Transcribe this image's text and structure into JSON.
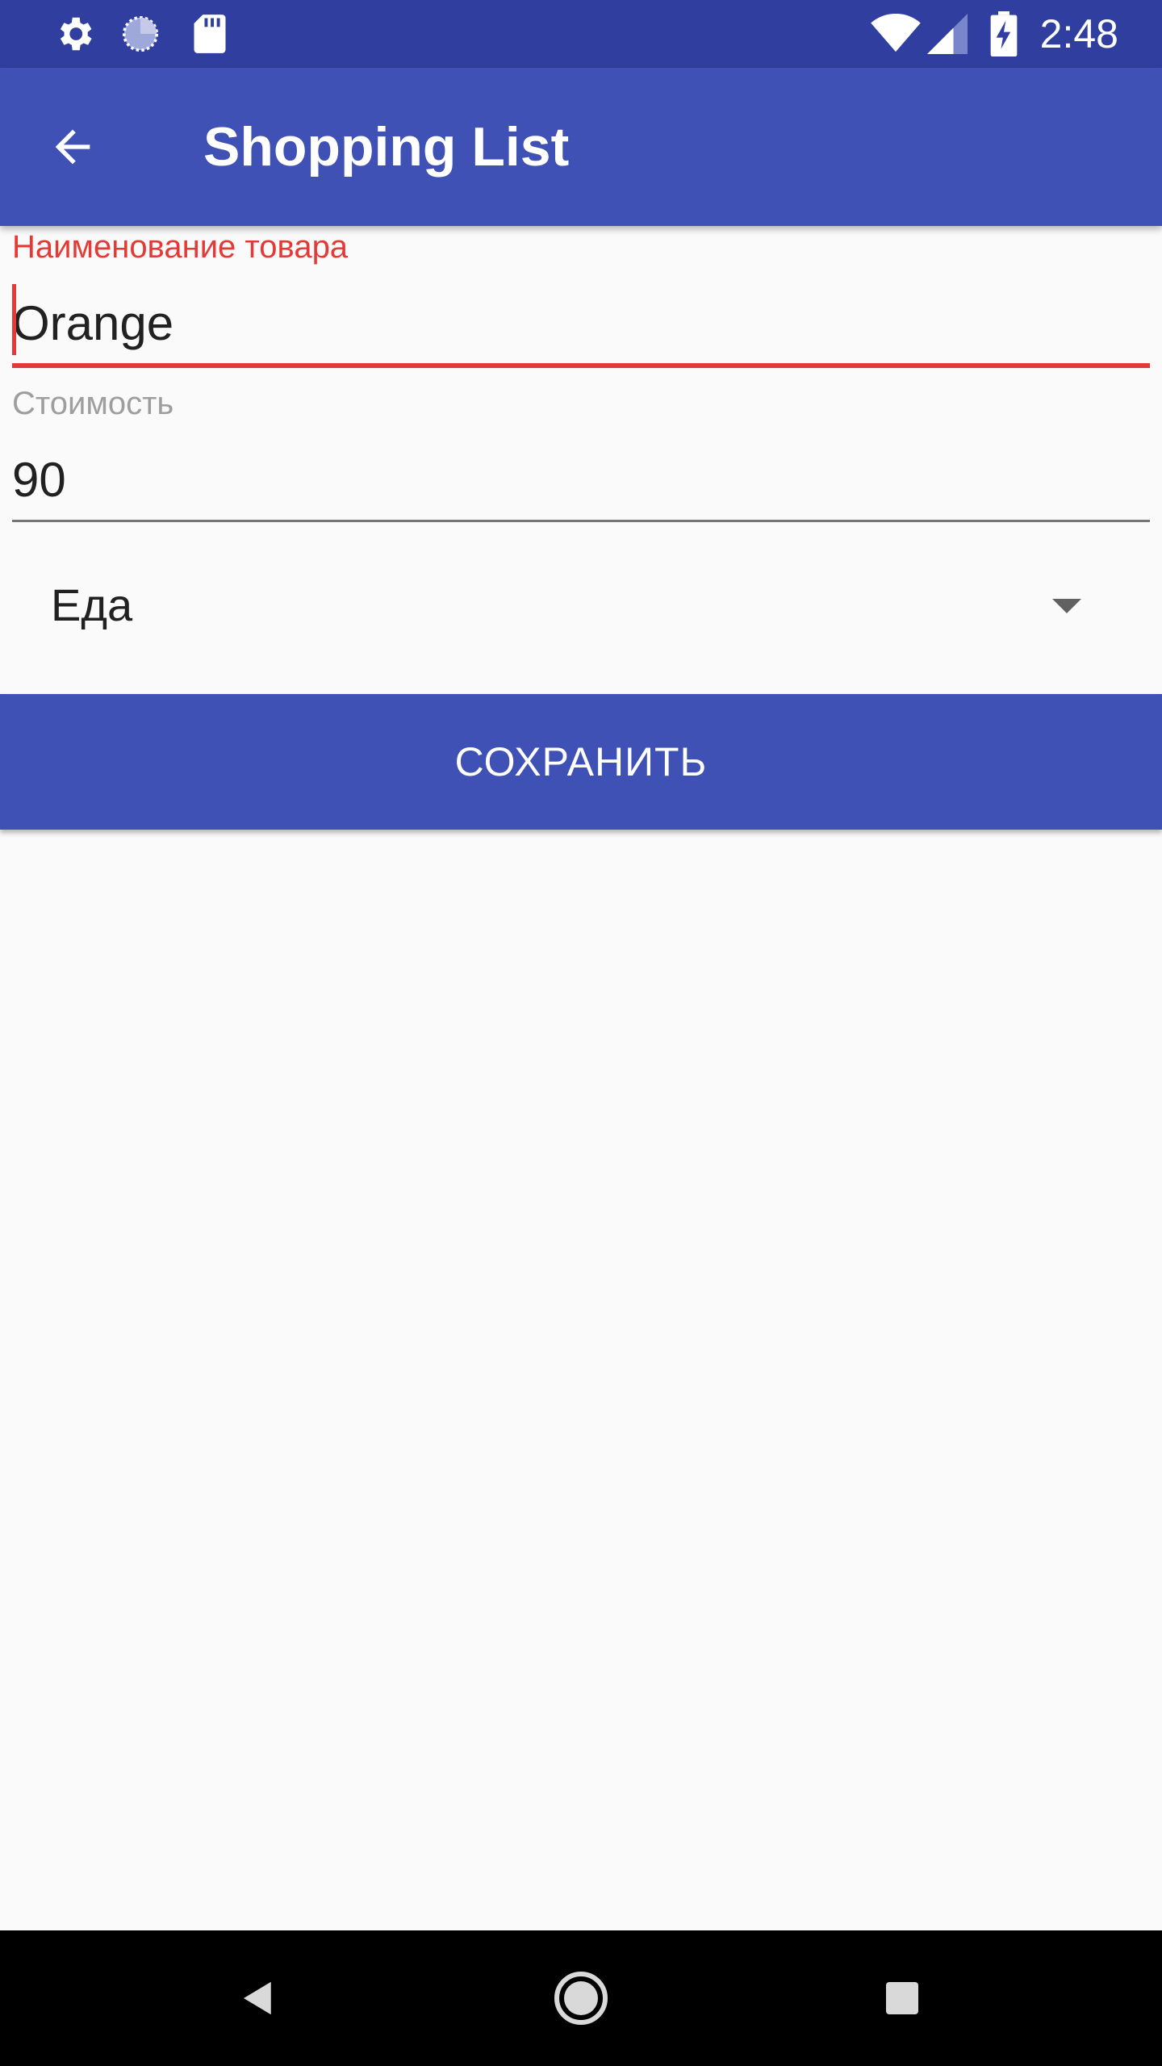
{
  "colors": {
    "status_bar": "#303f9f",
    "primary": "#3f51b5",
    "error_accent": "#e53935",
    "background": "#fafafa",
    "nav_bar": "#000000"
  },
  "status_bar": {
    "icons_left": [
      "settings-icon",
      "sync-progress-icon",
      "sd-card-icon"
    ],
    "icons_right": [
      "wifi-icon",
      "signal-icon",
      "battery-charging-icon"
    ],
    "time": "2:48"
  },
  "app_bar": {
    "back_icon": "arrow-back-icon",
    "title": "Shopping List"
  },
  "form": {
    "name_label": "Наименование товара",
    "name_value": "Orange",
    "price_label": "Стоимость",
    "price_value": "90",
    "category_selected": "Еда",
    "save_label": "СОХРАНИТЬ"
  },
  "nav_bar": {
    "icons": [
      "back-triangle-icon",
      "home-circle-icon",
      "recents-square-icon"
    ]
  }
}
